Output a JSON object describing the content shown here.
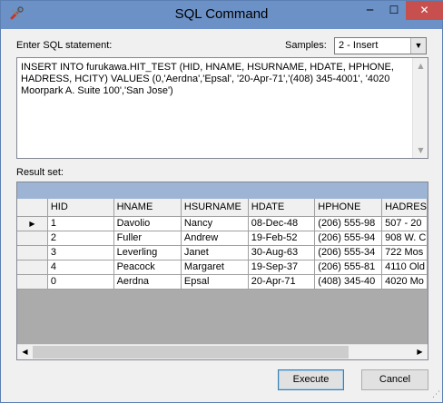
{
  "window": {
    "title": "SQL Command",
    "minimize_glyph": "─",
    "maximize_glyph": "☐",
    "close_glyph": "✕"
  },
  "sql_label": "Enter SQL statement:",
  "samples": {
    "label": "Samples:",
    "selected": "2 - Insert"
  },
  "sql_text": "INSERT INTO furukawa.HIT_TEST (HID, HNAME, HSURNAME, HDATE, HPHONE, HADRESS, HCITY) VALUES (0,'Aerdna','Epsal', '20-Apr-71','(408) 345-4001', '4020 Moorpark A. Suite 100','San Jose')",
  "result_label": "Result set:",
  "grid": {
    "columns": [
      "HID",
      "HNAME",
      "HSURNAME",
      "HDATE",
      "HPHONE",
      "HADRES"
    ],
    "rows": [
      [
        "1",
        "Davolio",
        "Nancy",
        "08-Dec-48",
        "(206) 555-98",
        "507 - 20"
      ],
      [
        "2",
        "Fuller",
        "Andrew",
        "19-Feb-52",
        "(206) 555-94",
        "908 W. C"
      ],
      [
        "3",
        "Leverling",
        "Janet",
        "30-Aug-63",
        "(206) 555-34",
        "722 Mos"
      ],
      [
        "4",
        "Peacock",
        "Margaret",
        "19-Sep-37",
        "(206) 555-81",
        "4110 Old"
      ],
      [
        "0",
        "Aerdna",
        "Epsal",
        "20-Apr-71",
        "(408) 345-40",
        "4020 Mo"
      ]
    ],
    "current_row_indicator": "▶"
  },
  "buttons": {
    "execute": "Execute",
    "cancel": "Cancel"
  },
  "colors": {
    "titlebar": "#6b91c7",
    "close_button": "#c7504f",
    "grid_caption": "#9db4d4",
    "grid_background": "#ababab"
  },
  "icons": {
    "app": "wrench-icon",
    "dropdown": "chevron-down-icon"
  }
}
